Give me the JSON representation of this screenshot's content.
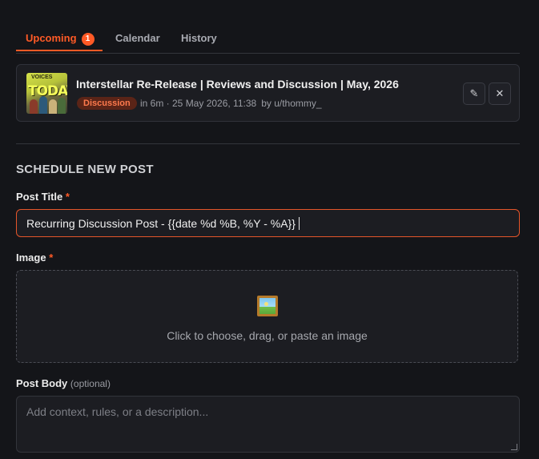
{
  "tabs": [
    {
      "label": "Upcoming",
      "badge": "1",
      "active": true
    },
    {
      "label": "Calendar"
    },
    {
      "label": "History"
    }
  ],
  "scheduled_post": {
    "thumbnail_text": "TODAY",
    "thumbnail_subtext": "VOICES",
    "title": "Interstellar Re-Release | Reviews and Discussion | May, 2026",
    "flair": "Discussion",
    "time": "in 6m · 25 May 2026, 11:38",
    "author": "by u/thommy_",
    "edit_icon": "✎",
    "close_icon": "✕"
  },
  "form": {
    "heading": "SCHEDULE NEW POST",
    "title_label": "Post Title",
    "title_required": "*",
    "title_value": "Recurring Discussion Post - {{date %d %B, %Y - %A}}",
    "image_label": "Image",
    "image_required": "*",
    "dropzone_text": "Click to choose, drag, or paste an image",
    "body_label": "Post Body",
    "body_optional": "(optional)",
    "body_placeholder": "Add context, rules, or a description..."
  },
  "colors": {
    "accent": "#ff5a26",
    "background": "#141519",
    "card": "#1c1d22",
    "flair_bg": "#5a2417"
  }
}
